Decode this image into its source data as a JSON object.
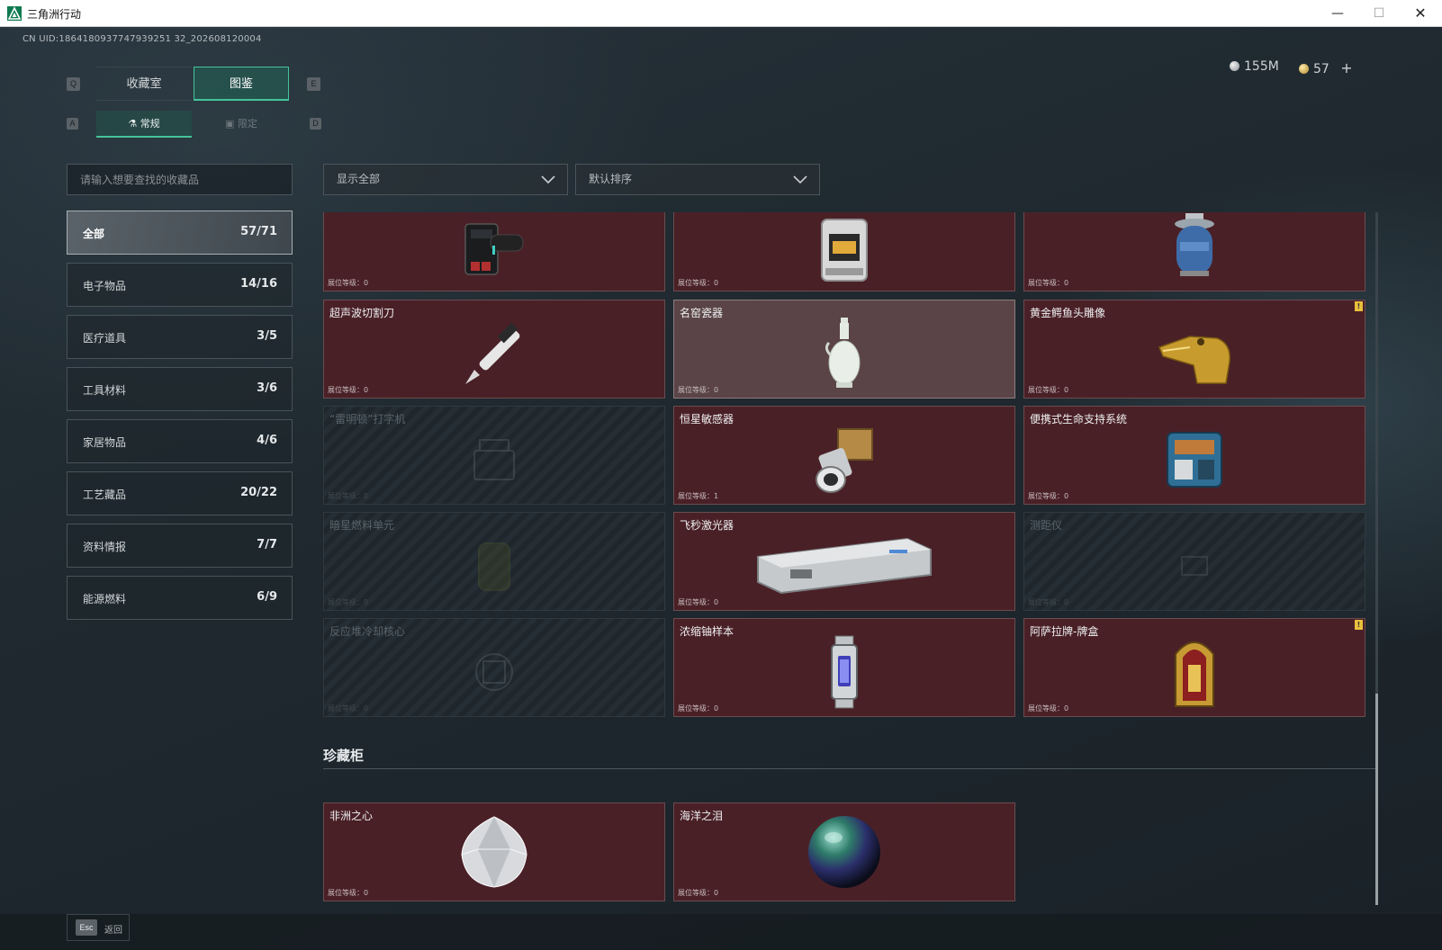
{
  "window": {
    "title": "三角洲行动",
    "minimize": "—",
    "maximize": "☐",
    "close": "✕"
  },
  "header": {
    "uid": "CN UID:1864180937747939251 32_202608120004",
    "silver": "155M",
    "gold": "57",
    "gold_add": "+"
  },
  "tabs": {
    "main": [
      {
        "label": "收藏室",
        "key": "Q"
      },
      {
        "label": "图鉴",
        "key": "E"
      }
    ],
    "sub": [
      {
        "label": "常规",
        "key": "A"
      },
      {
        "label": "限定",
        "key": "D"
      }
    ]
  },
  "search": {
    "placeholder": "请输入想要查找的收藏品"
  },
  "filters": {
    "display": "显示全部",
    "sort": "默认排序"
  },
  "categories": [
    {
      "label": "全部",
      "count": "57/71"
    },
    {
      "label": "电子物品",
      "count": "14/16"
    },
    {
      "label": "医疗道具",
      "count": "3/5"
    },
    {
      "label": "工具材料",
      "count": "3/6"
    },
    {
      "label": "家居物品",
      "count": "4/6"
    },
    {
      "label": "工艺藏品",
      "count": "20/22"
    },
    {
      "label": "资料情报",
      "count": "7/7"
    },
    {
      "label": "能源燃料",
      "count": "6/9"
    }
  ],
  "level_label": "展位等级：",
  "items": [
    {
      "name": "",
      "level": "0",
      "icon": "rugged-device-icon"
    },
    {
      "name": "",
      "level": "0",
      "icon": "reactor-lamp-icon"
    },
    {
      "name": "",
      "level": "0",
      "icon": "gas-canister-icon"
    },
    {
      "name": "超声波切割刀",
      "level": "0",
      "icon": "ultrasonic-cutter-icon"
    },
    {
      "name": "名窑瓷器",
      "level": "0",
      "icon": "porcelain-vase-icon"
    },
    {
      "name": "黄金鳄鱼头雕像",
      "level": "0",
      "icon": "golden-crocodile-icon",
      "flag": "!"
    },
    {
      "name": "“雷明顿”打字机",
      "level": "0",
      "icon": "typewriter-icon"
    },
    {
      "name": "恒星敏感器",
      "level": "1",
      "icon": "star-sensor-icon"
    },
    {
      "name": "便携式生命支持系统",
      "level": "0",
      "icon": "life-support-icon"
    },
    {
      "name": "暗星燃料单元",
      "level": "0",
      "icon": "fuel-cell-icon"
    },
    {
      "name": "飞秒激光器",
      "level": "0",
      "icon": "femtosecond-laser-icon"
    },
    {
      "name": "测距仪",
      "level": "0",
      "icon": "rangefinder-icon"
    },
    {
      "name": "反应堆冷却核心",
      "level": "0",
      "icon": "reactor-core-icon"
    },
    {
      "name": "浓缩铀样本",
      "level": "0",
      "icon": "uranium-sample-icon"
    },
    {
      "name": "阿萨拉牌-牌盒",
      "level": "0",
      "icon": "card-box-icon",
      "flag": "!"
    }
  ],
  "vault": {
    "title": "珍藏柜",
    "items": [
      {
        "name": "非洲之心",
        "level": "0",
        "icon": "diamond-icon"
      },
      {
        "name": "海洋之泪",
        "level": "0",
        "icon": "ocean-pearl-icon"
      }
    ]
  },
  "footer": {
    "esc": "Esc",
    "back": "返回"
  },
  "colors": {
    "accent": "#45c49a",
    "card_bg": "#4a2027",
    "card_highlight": "#5a4447",
    "locked_bg": "#1f272d"
  }
}
